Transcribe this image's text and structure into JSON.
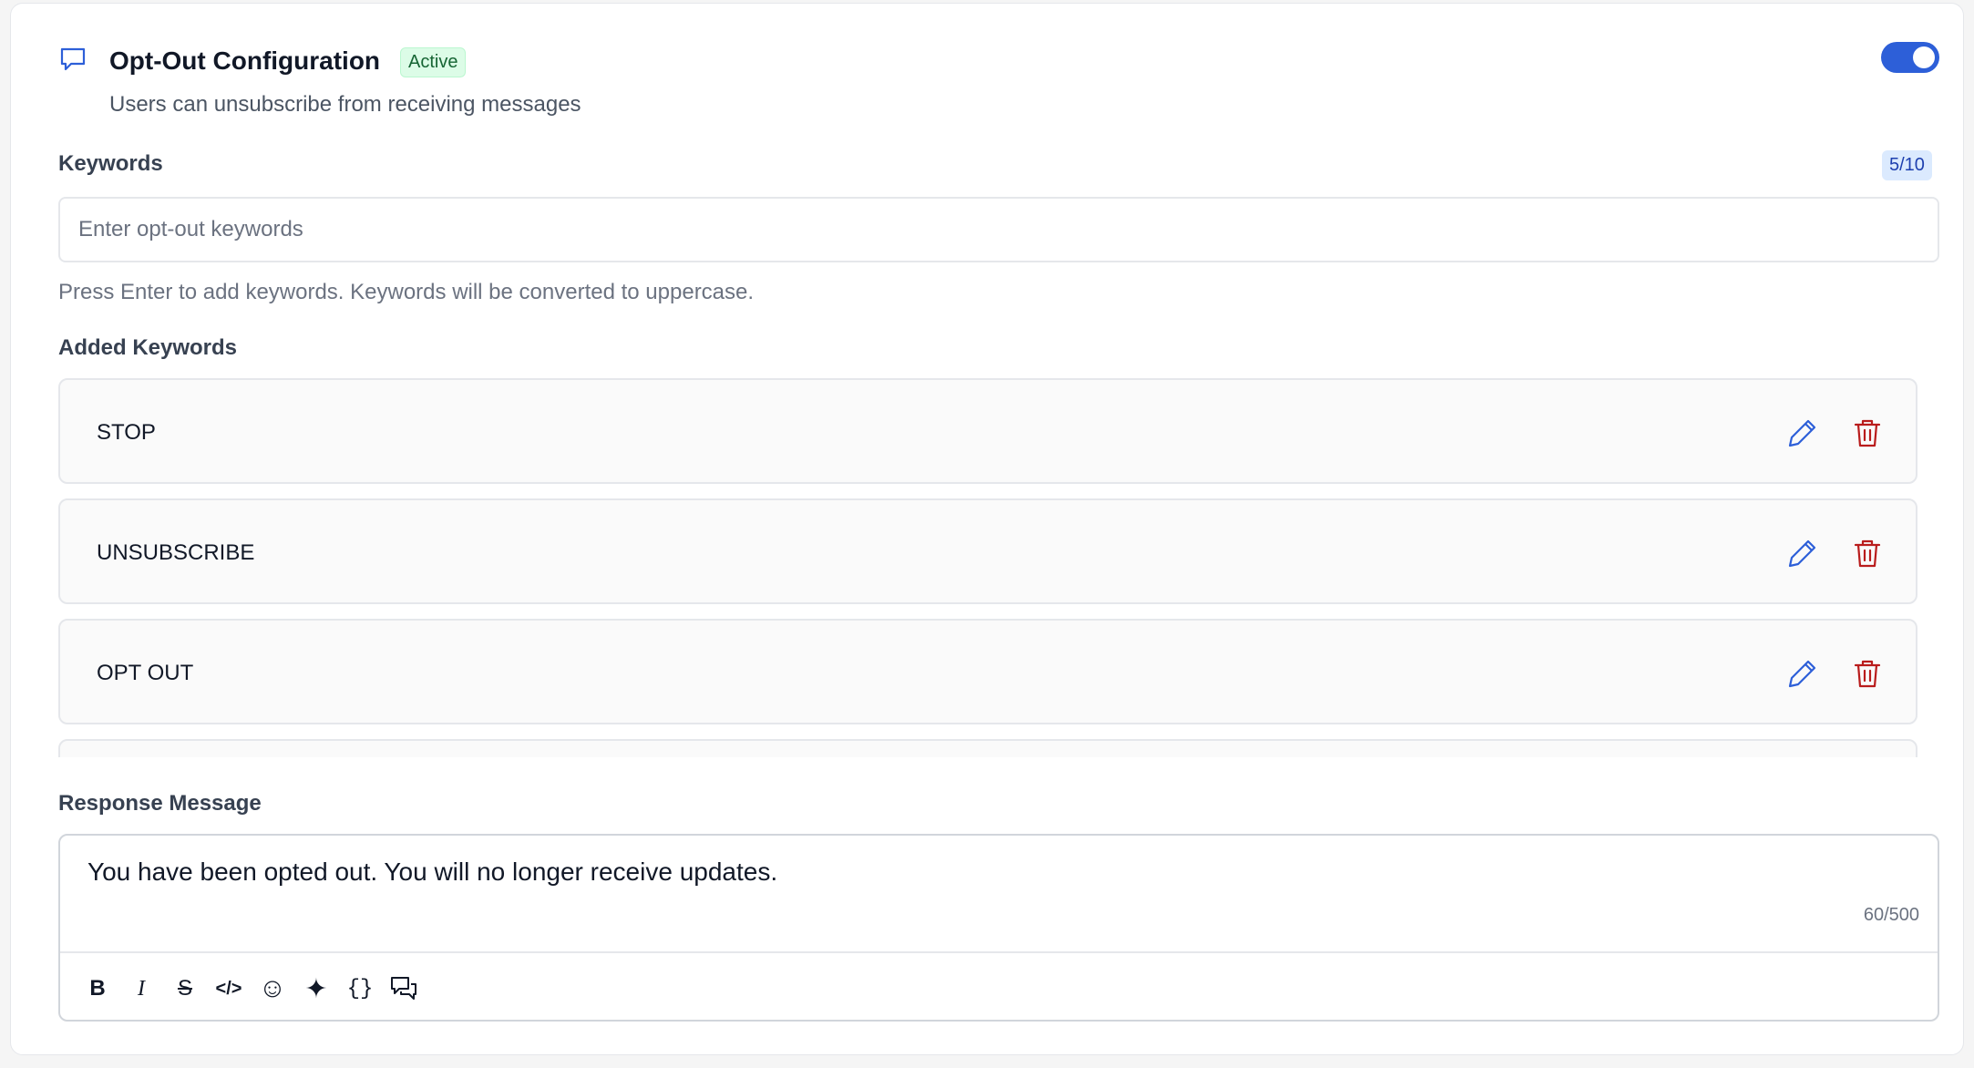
{
  "header": {
    "icon": "message-square-icon",
    "title": "Opt-Out Configuration",
    "status_badge": "Active",
    "subtitle": "Users can unsubscribe from receiving messages",
    "toggle_enabled": true,
    "accent_color": "#2d5fd8"
  },
  "keywords": {
    "label": "Keywords",
    "count": "5/10",
    "input_placeholder": "Enter opt-out keywords",
    "input_value": "",
    "hint": "Press Enter to add keywords. Keywords will be converted to uppercase."
  },
  "added_keywords": {
    "label": "Added Keywords",
    "items": [
      {
        "text": "STOP"
      },
      {
        "text": "UNSUBSCRIBE"
      },
      {
        "text": "OPT OUT"
      },
      {
        "text": ""
      }
    ],
    "edit_icon": "pencil-icon",
    "delete_icon": "trash-icon"
  },
  "response": {
    "label": "Response Message",
    "text": "You have been opted out. You will no longer receive updates.",
    "char_count": "60/500",
    "toolbar": [
      {
        "name": "bold-icon",
        "glyph": "B"
      },
      {
        "name": "italic-icon",
        "glyph": "I"
      },
      {
        "name": "strikethrough-icon",
        "glyph": "S"
      },
      {
        "name": "code-icon",
        "glyph": "</>"
      },
      {
        "name": "emoji-icon",
        "glyph": "☺"
      },
      {
        "name": "sparkles-icon",
        "glyph": "✦"
      },
      {
        "name": "variable-braces-icon",
        "glyph": "{}"
      },
      {
        "name": "chat-bubbles-icon",
        "glyph": ""
      }
    ]
  }
}
